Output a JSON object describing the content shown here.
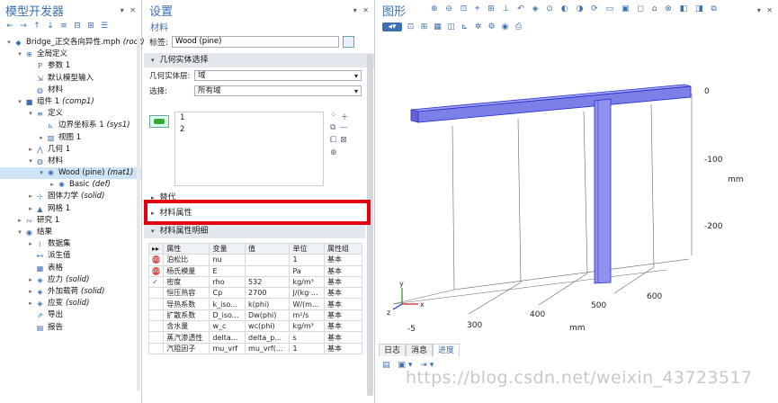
{
  "builder": {
    "title": "模型开发器",
    "tree": [
      {
        "label": "Bridge_正交各向异性.mph",
        "suffix": "(root)",
        "depth": 0,
        "exp": "▾",
        "icon": "model-icon"
      },
      {
        "label": "全局定义",
        "suffix": "",
        "depth": 1,
        "exp": "▾",
        "icon": "globe-icon"
      },
      {
        "label": "参数 1",
        "suffix": "",
        "depth": 2,
        "exp": "",
        "icon": "parameters-icon"
      },
      {
        "label": "默认模型输入",
        "suffix": "",
        "depth": 2,
        "exp": "",
        "icon": "model-input-icon"
      },
      {
        "label": "材料",
        "suffix": "",
        "depth": 2,
        "exp": "",
        "icon": "materials-icon"
      },
      {
        "label": "组件 1",
        "suffix": "(comp1)",
        "depth": 1,
        "exp": "▾",
        "icon": "component-icon"
      },
      {
        "label": "定义",
        "suffix": "",
        "depth": 2,
        "exp": "▾",
        "icon": "definitions-icon"
      },
      {
        "label": "边界坐标系 1",
        "suffix": "(sys1)",
        "depth": 3,
        "exp": "",
        "icon": "coordinate-system-icon"
      },
      {
        "label": "视图 1",
        "suffix": "",
        "depth": 3,
        "exp": "▸",
        "icon": "view-icon"
      },
      {
        "label": "几何 1",
        "suffix": "",
        "depth": 2,
        "exp": "▸",
        "icon": "geometry-icon"
      },
      {
        "label": "材料",
        "suffix": "",
        "depth": 2,
        "exp": "▾",
        "icon": "materials-icon"
      },
      {
        "label": "Wood (pine)",
        "suffix": "(mat1)",
        "depth": 3,
        "exp": "▾",
        "icon": "material-node-icon",
        "selected": true
      },
      {
        "label": "Basic",
        "suffix": "(def)",
        "depth": 4,
        "exp": "▸",
        "icon": "material-node-icon"
      },
      {
        "label": "固体力学",
        "suffix": "(solid)",
        "depth": 2,
        "exp": "▸",
        "icon": "solid-mechanics-icon"
      },
      {
        "label": "网格 1",
        "suffix": "",
        "depth": 2,
        "exp": "▸",
        "icon": "mesh-icon"
      },
      {
        "label": "研究 1",
        "suffix": "",
        "depth": 1,
        "exp": "▸",
        "icon": "study-icon"
      },
      {
        "label": "结果",
        "suffix": "",
        "depth": 1,
        "exp": "▾",
        "icon": "results-icon"
      },
      {
        "label": "数据集",
        "suffix": "",
        "depth": 2,
        "exp": "▸",
        "icon": "datasets-icon"
      },
      {
        "label": "派生值",
        "suffix": "",
        "depth": 2,
        "exp": "",
        "icon": "derived-values-icon"
      },
      {
        "label": "表格",
        "suffix": "",
        "depth": 2,
        "exp": "",
        "icon": "tables-icon"
      },
      {
        "label": "应力",
        "suffix": "(solid)",
        "depth": 2,
        "exp": "▸",
        "icon": "plot-group-icon"
      },
      {
        "label": "外加载荷",
        "suffix": "(solid)",
        "depth": 2,
        "exp": "▸",
        "icon": "plot-group-icon"
      },
      {
        "label": "应变",
        "suffix": "(solid)",
        "depth": 2,
        "exp": "▸",
        "icon": "plot-group-icon"
      },
      {
        "label": "导出",
        "suffix": "",
        "depth": 2,
        "exp": "",
        "icon": "export-icon"
      },
      {
        "label": "报告",
        "suffix": "",
        "depth": 2,
        "exp": "",
        "icon": "report-icon"
      }
    ]
  },
  "settings": {
    "title": "设置",
    "subtitle": "材料",
    "label_caption": "标签:",
    "label_value": "Wood (pine)",
    "geom_section": "几何实体选择",
    "geom_level_caption": "几何实体层:",
    "geom_level_value": "域",
    "selection_caption": "选择:",
    "selection_value": "所有域",
    "list_items": [
      "1",
      "2"
    ],
    "override_section": "替代",
    "props_section": "材料属性",
    "props_detail_section": "材料属性明细",
    "table": {
      "headers": [
        "",
        "属性",
        "变量",
        "值",
        "单位",
        "属性组"
      ],
      "rows": [
        {
          "status": "stop",
          "name": "泊松比",
          "var": "nu",
          "value": "",
          "unit": "1",
          "group": "基本"
        },
        {
          "status": "stop",
          "name": "杨氏模量",
          "var": "E",
          "value": "",
          "unit": "Pa",
          "group": "基本"
        },
        {
          "status": "check",
          "name": "密度",
          "var": "rho",
          "value": "532",
          "unit": "kg/m³",
          "group": "基本"
        },
        {
          "status": "",
          "name": "恒压热容",
          "var": "Cp",
          "value": "2700",
          "unit": "J/(kg·...",
          "group": "基本"
        },
        {
          "status": "",
          "name": "导热系数",
          "var": "k_iso...",
          "value": "k(phi)",
          "unit": "W/(m...",
          "group": "基本"
        },
        {
          "status": "",
          "name": "扩散系数",
          "var": "D_iso...",
          "value": "Dw(phi)",
          "unit": "m²/s",
          "group": "基本"
        },
        {
          "status": "",
          "name": "含水量",
          "var": "w_c",
          "value": "wc(phi)",
          "unit": "kg/m³",
          "group": "基本"
        },
        {
          "status": "",
          "name": "蒸汽渗透性",
          "var": "delta...",
          "value": "delta_p...",
          "unit": "s",
          "group": "基本"
        },
        {
          "status": "",
          "name": "汽阻因子",
          "var": "mu_vrf",
          "value": "mu_vrf(...",
          "unit": "1",
          "group": "基本"
        }
      ]
    }
  },
  "graphics": {
    "title": "图形",
    "axis_right_ticks": [
      "0",
      "-100",
      "-200"
    ],
    "axis_right_unit": "mm",
    "axis_bottom_ticks": [
      "300",
      "400",
      "500",
      "600"
    ],
    "axis_bottom_unit": "mm",
    "axis_left_tick": "-5",
    "triad": {
      "x": "x",
      "y": "y",
      "z": "z"
    },
    "beam_color": "#7b7fe6"
  },
  "messages": {
    "tabs": [
      "日志",
      "消息",
      "进度"
    ]
  },
  "watermark": "https://blog.csdn.net/weixin_43723517"
}
